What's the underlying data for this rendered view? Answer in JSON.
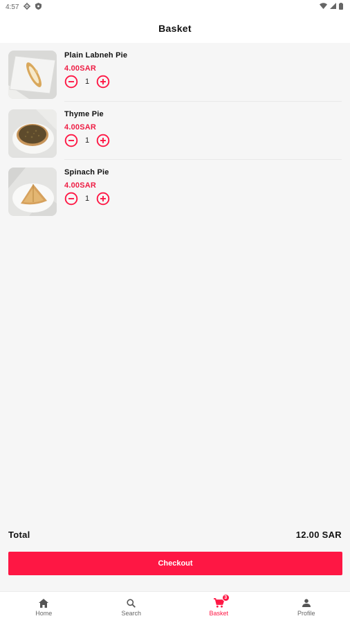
{
  "status_bar": {
    "time": "4:57"
  },
  "header": {
    "title": "Basket"
  },
  "basket": {
    "items": [
      {
        "name": "Plain Labneh Pie",
        "price": "4.00SAR",
        "quantity": "1",
        "image_icon": "labneh-pie-photo"
      },
      {
        "name": "Thyme Pie",
        "price": "4.00SAR",
        "quantity": "1",
        "image_icon": "thyme-pie-photo"
      },
      {
        "name": "Spinach Pie",
        "price": "4.00SAR",
        "quantity": "1",
        "image_icon": "spinach-pie-photo"
      }
    ],
    "total_label": "Total",
    "total_value": "12.00 SAR",
    "checkout_label": "Checkout"
  },
  "bottom_nav": {
    "items": [
      {
        "label": "Home",
        "icon": "home-icon",
        "active": false
      },
      {
        "label": "Search",
        "icon": "search-icon",
        "active": false
      },
      {
        "label": "Basket",
        "icon": "cart-icon",
        "active": true,
        "badge": "3"
      },
      {
        "label": "Profile",
        "icon": "person-icon",
        "active": false
      }
    ]
  },
  "colors": {
    "accent": "#fe1744",
    "price": "#ee1d44",
    "background": "#f6f6f6"
  }
}
